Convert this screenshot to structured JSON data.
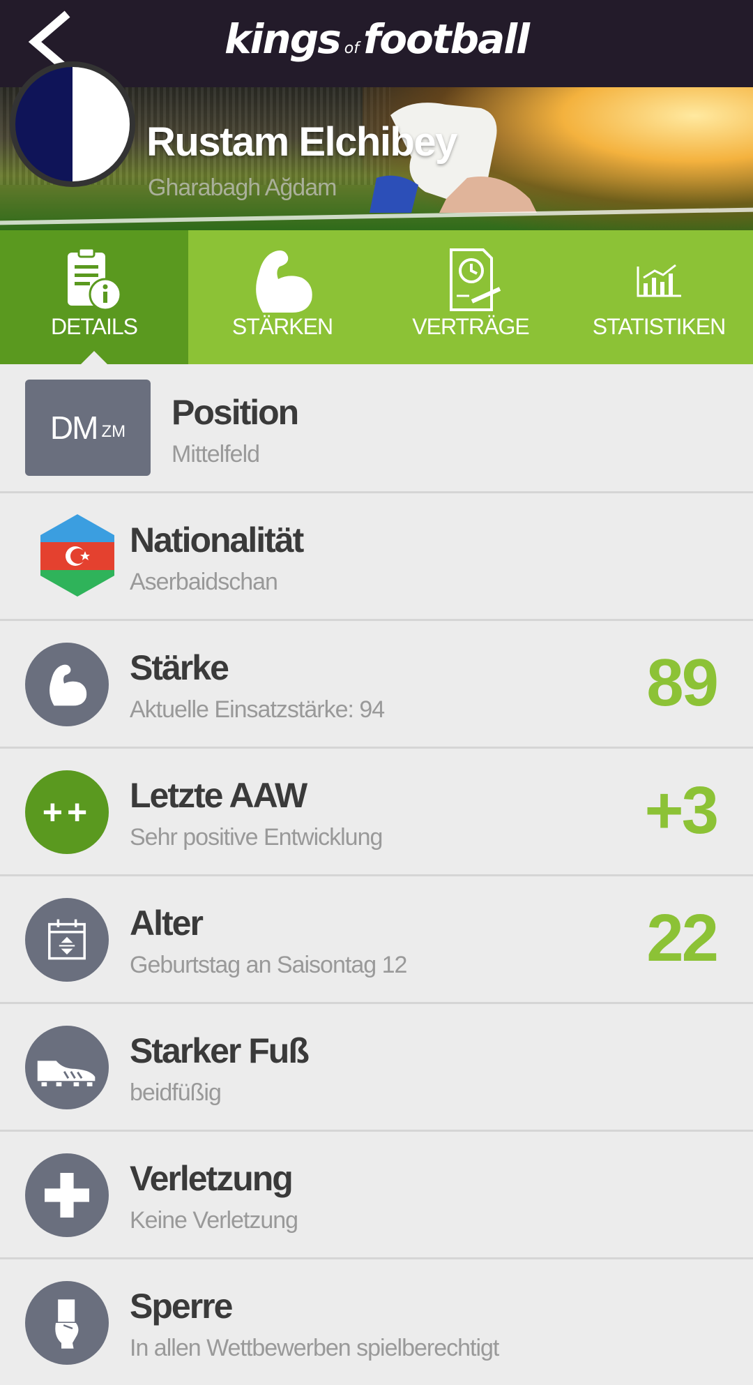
{
  "header": {
    "logo_main_1": "kings",
    "logo_of": "of",
    "logo_main_2": "football",
    "back_icon": "chevron-left-icon"
  },
  "player": {
    "name": "Rustam Elchibey",
    "club": "Gharabagh Ağdam",
    "club_colors": [
      "#0f1458",
      "#ffffff"
    ]
  },
  "tabs": [
    {
      "label": "DETAILS",
      "icon": "document-info-icon",
      "active": true
    },
    {
      "label": "STÄRKEN",
      "icon": "bicep-icon",
      "active": false
    },
    {
      "label": "VERTRÄGE",
      "icon": "contract-clock-icon",
      "active": false
    },
    {
      "label": "STATISTIKEN",
      "icon": "bar-chart-icon",
      "active": false
    }
  ],
  "details": {
    "position": {
      "title": "Position",
      "sub": "Mittelfeld",
      "main": "DM",
      "alt": "ZM"
    },
    "nationality": {
      "title": "Nationalität",
      "sub": "Aserbaidschan",
      "icon": "azerbaijan-flag-icon"
    },
    "strength": {
      "title": "Stärke",
      "sub": "Aktuelle Einsatzstärke: 94",
      "value": "89",
      "icon": "bicep-icon"
    },
    "last_aaw": {
      "title": "Letzte AAW",
      "sub": "Sehr positive Entwicklung",
      "value": "+3",
      "badge": "++"
    },
    "age": {
      "title": "Alter",
      "sub": "Geburtstag an Saisontag 12",
      "value": "22",
      "icon": "calendar-icon"
    },
    "foot": {
      "title": "Starker Fuß",
      "sub": "beidfüßig",
      "icon": "football-boot-icon"
    },
    "injury": {
      "title": "Verletzung",
      "sub": "Keine Verletzung",
      "icon": "medical-cross-icon"
    },
    "suspension": {
      "title": "Sperre",
      "sub": "In allen Wettbewerben spielberechtigt",
      "icon": "hand-card-icon"
    }
  },
  "colors": {
    "accent_green": "#8cc236",
    "active_tab_green": "#5a991f",
    "icon_gray": "#6a6f7e",
    "header_dark": "#231b2a"
  }
}
